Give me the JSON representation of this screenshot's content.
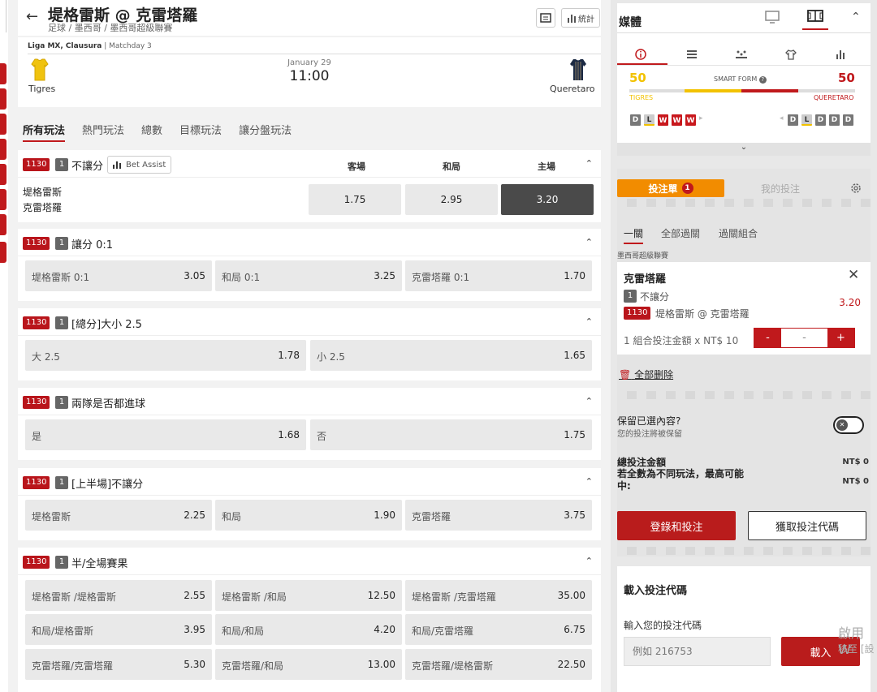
{
  "header": {
    "title": "堤格雷斯 @ 克雷塔羅",
    "breadcrumb": "足球  /  墨西哥  /  墨西哥超級聯賽",
    "stats_label": "統計"
  },
  "match": {
    "league": "Liga MX, Clausura",
    "matchday": " | Matchday 3",
    "date": "January 29",
    "time": "11:00",
    "home": "Tigres",
    "away": "Queretaro"
  },
  "tabs": [
    "所有玩法",
    "熱門玩法",
    "總數",
    "目標玩法",
    "讓分盤玩法"
  ],
  "markets": {
    "m1": {
      "code": "1130",
      "num": "1",
      "name": "不讓分",
      "assist": "Bet Assist",
      "cols": [
        "客場",
        "和局",
        "主場"
      ],
      "team1": "堤格雷斯",
      "team2": "克雷塔羅",
      "odds": [
        "1.75",
        "2.95",
        "3.20"
      ]
    },
    "m2": {
      "code": "1130",
      "num": "1",
      "name": "讓分 0:1",
      "o": [
        {
          "l": "堤格雷斯 0:1",
          "v": "3.05"
        },
        {
          "l": "和局 0:1",
          "v": "3.25"
        },
        {
          "l": "克雷塔羅 0:1",
          "v": "1.70"
        }
      ]
    },
    "m3": {
      "code": "1130",
      "num": "1",
      "name": "[總分]大小 2.5",
      "o": [
        {
          "l": "大 2.5",
          "v": "1.78"
        },
        {
          "l": "小 2.5",
          "v": "1.65"
        }
      ]
    },
    "m4": {
      "code": "1130",
      "num": "1",
      "name": "兩隊是否都進球",
      "o": [
        {
          "l": "是",
          "v": "1.68"
        },
        {
          "l": "否",
          "v": "1.75"
        }
      ]
    },
    "m5": {
      "code": "1130",
      "num": "1",
      "name": "[上半場]不讓分",
      "o": [
        {
          "l": "堤格雷斯",
          "v": "2.25"
        },
        {
          "l": "和局",
          "v": "1.90"
        },
        {
          "l": "克雷塔羅",
          "v": "3.75"
        }
      ]
    },
    "m6": {
      "code": "1130",
      "num": "1",
      "name": "半/全場賽果",
      "o": [
        {
          "l": "堤格雷斯 /堤格雷斯",
          "v": "2.55"
        },
        {
          "l": "堤格雷斯 /和局",
          "v": "12.50"
        },
        {
          "l": "堤格雷斯 /克雷塔羅",
          "v": "35.00"
        },
        {
          "l": "和局/堤格雷斯",
          "v": "3.95"
        },
        {
          "l": "和局/和局",
          "v": "4.20"
        },
        {
          "l": "和局/克雷塔羅",
          "v": "6.75"
        },
        {
          "l": "克雷塔羅/克雷塔羅",
          "v": "5.30"
        },
        {
          "l": "克雷塔羅/和局",
          "v": "13.00"
        },
        {
          "l": "克雷塔羅/堤格雷斯",
          "v": "22.50"
        }
      ]
    }
  },
  "media": {
    "title": "媒體",
    "home_score": "50",
    "away_score": "50",
    "smart_form": "SMART FORM",
    "home_name": "TIGRES",
    "away_name": "QUERETARO",
    "home_form": [
      "D",
      "L",
      "W",
      "W",
      "W"
    ],
    "away_form": [
      "D",
      "L",
      "D",
      "D",
      "D"
    ]
  },
  "betslip": {
    "tab_active": "投注單",
    "count": "1",
    "tab_other": "我的投注",
    "subtabs": [
      "一關",
      "全部過關",
      "過關組合"
    ],
    "league": "墨西哥超級聯賽",
    "selection": "克雷塔羅",
    "market_num": "1",
    "market_name": "不讓分",
    "event_code": "1130",
    "event": "堤格雷斯 @ 克雷塔羅",
    "odds": "3.20",
    "stake_label": "1 組合投注金額 x NT$ 10",
    "stake_minus": "-",
    "stake_value": "-",
    "stake_plus": "+",
    "remove_all": "全部删除",
    "keep_title": "保留已選內容?",
    "keep_sub": "您的投注將被保留",
    "total_label": "總投注金額",
    "total_value": "NT$ 0",
    "max_label": "若全數為不同玩法，最高可能中:",
    "max_value": "NT$ 0",
    "login_btn": "登錄和投注",
    "code_btn": "獲取投注代碼"
  },
  "loadcode": {
    "title": "載入投注代碼",
    "label": "輸入您的投注代碼",
    "placeholder": "例如 216753",
    "button": "載入"
  },
  "watermark": {
    "line1": "啟用 W",
    "line2": "移至 [設"
  },
  "colors": {
    "accent": "#c0191c",
    "orange": "#f28c00",
    "selected": "#4a4a4a"
  }
}
